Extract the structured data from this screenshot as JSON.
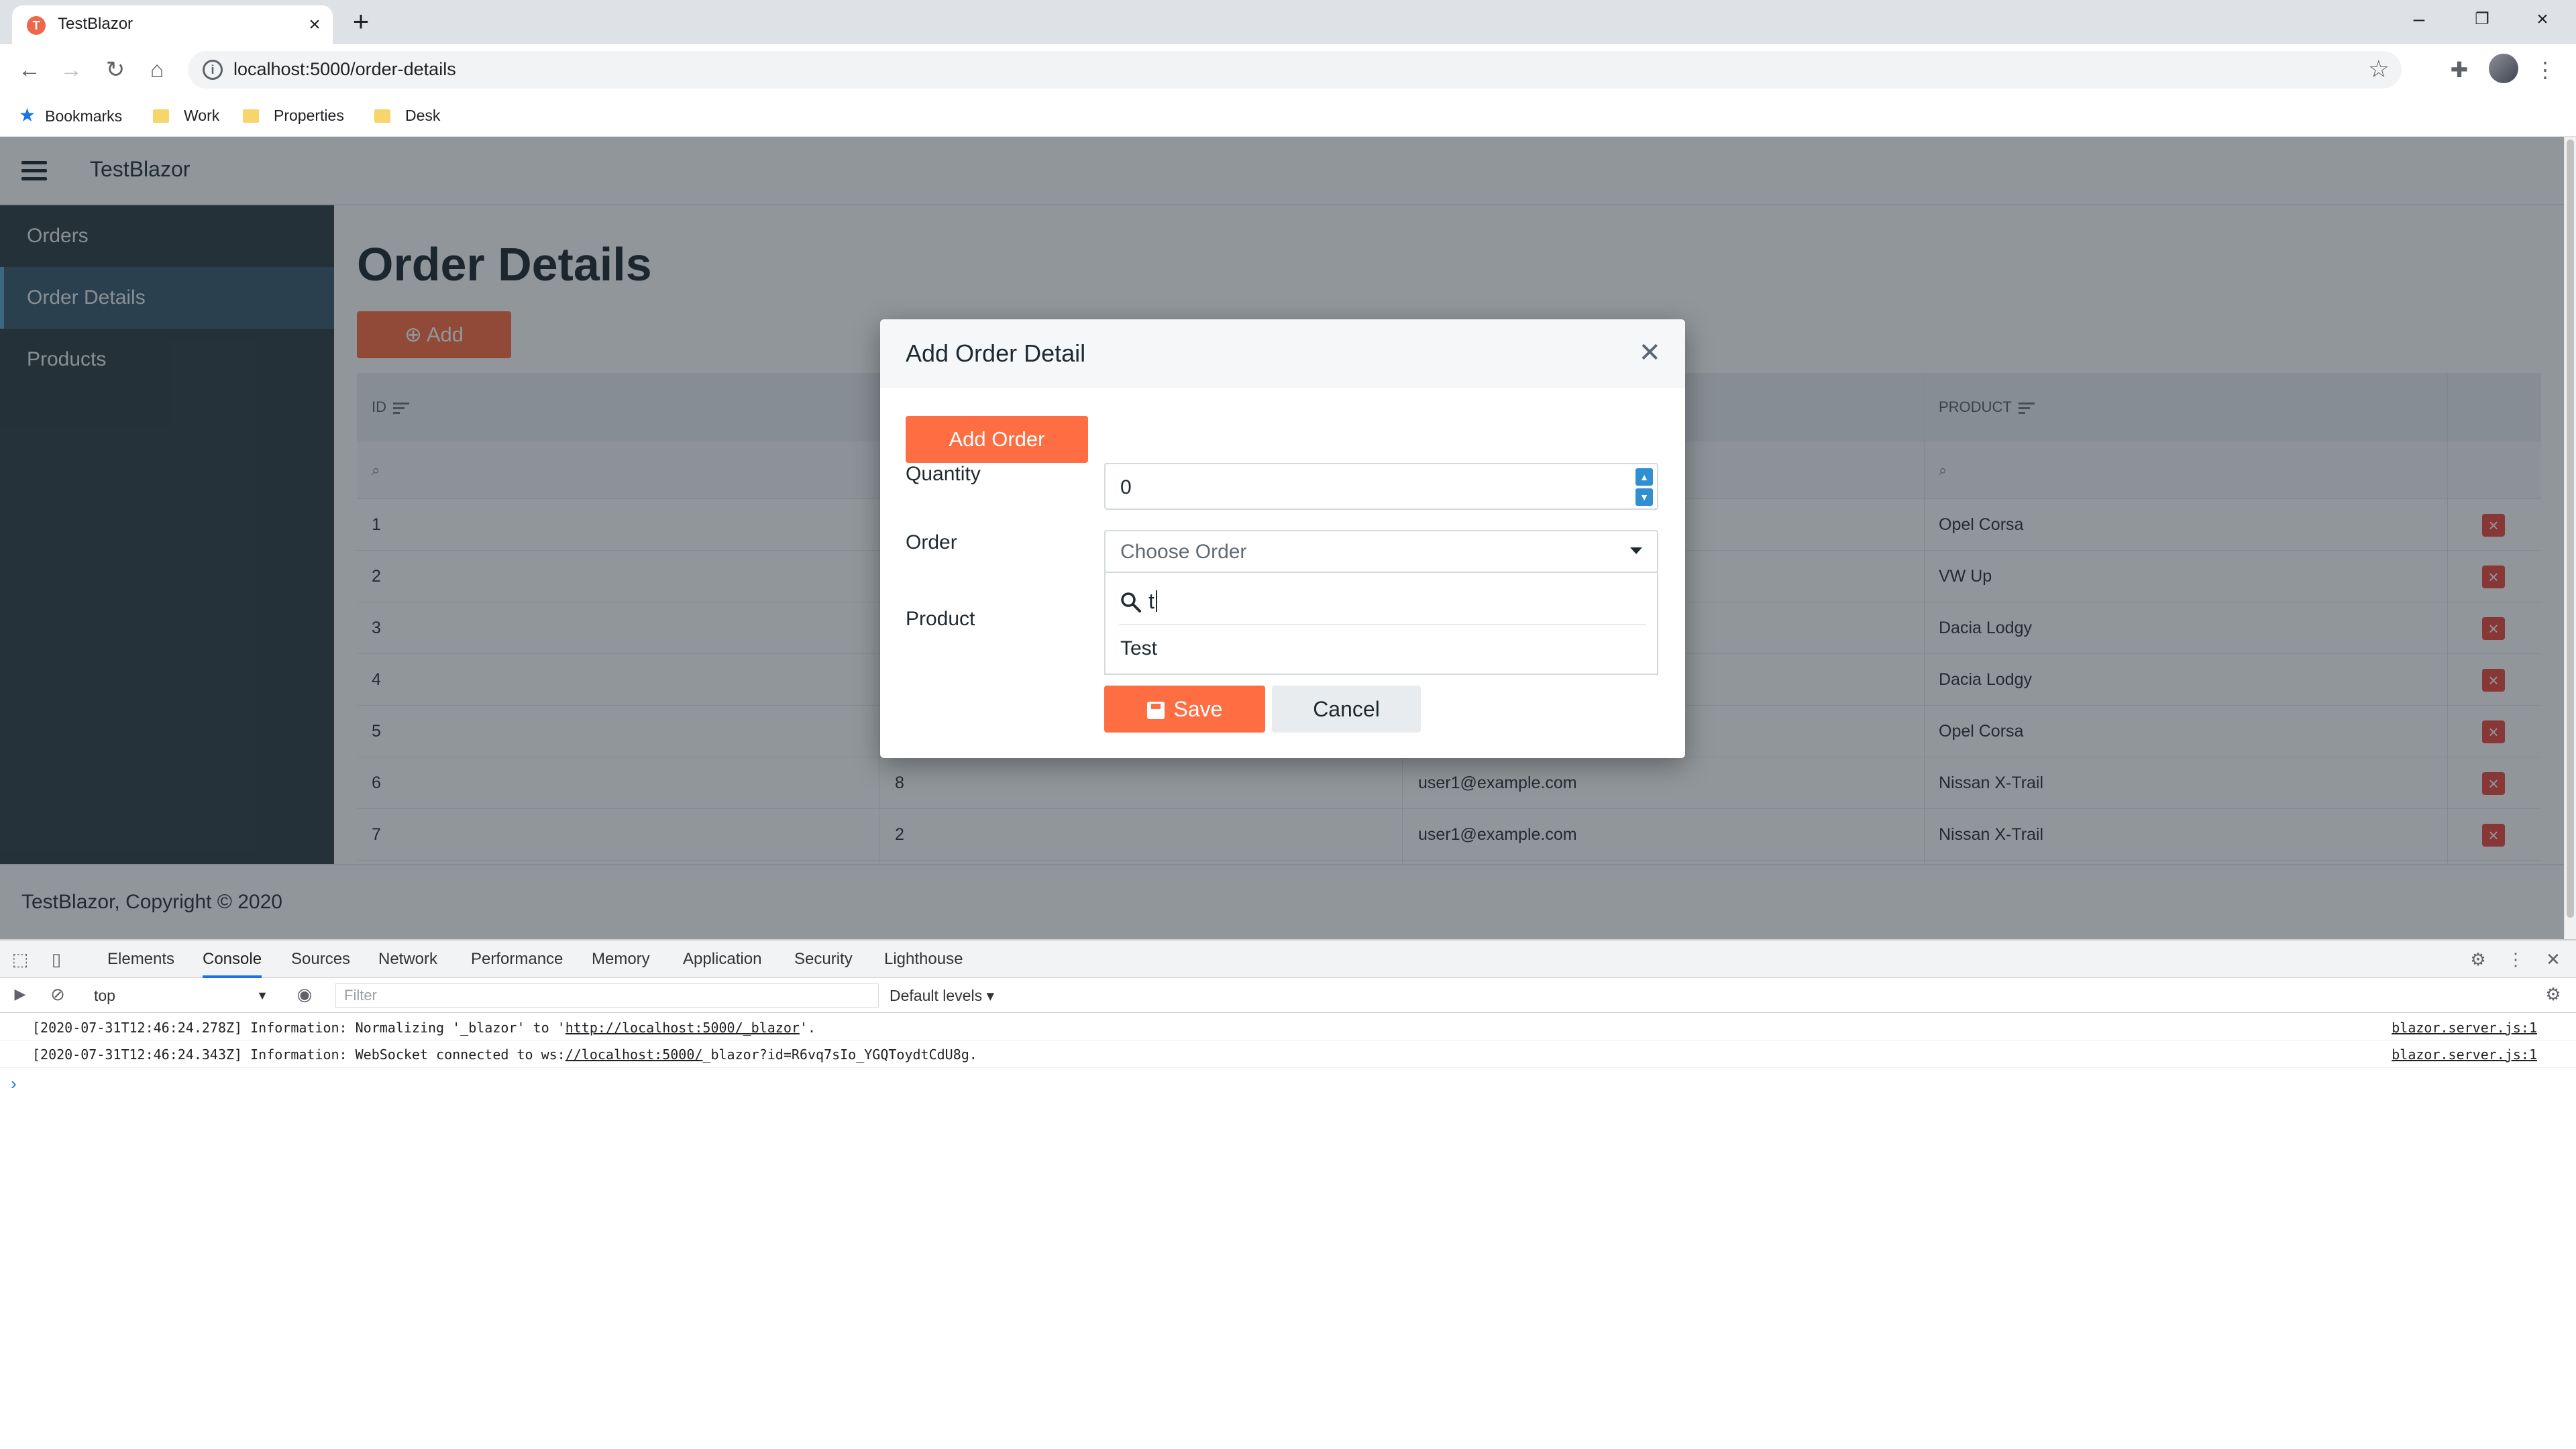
{
  "browser": {
    "tab_title": "TestBlazor",
    "tab_favicon": "T",
    "url": "localhost:5000/order-details",
    "bookmarks": [
      "Bookmarks",
      "Work",
      "Properties",
      "Desk"
    ]
  },
  "app": {
    "brand": "TestBlazor",
    "sidebar": [
      {
        "label": "Orders"
      },
      {
        "label": "Order Details"
      },
      {
        "label": "Products"
      }
    ],
    "page_title": "Order Details",
    "add_label": "Add",
    "grid": {
      "columns": [
        "ID",
        "",
        "",
        "Product"
      ],
      "rows": [
        {
          "id": "1",
          "quantity": "",
          "email": "",
          "product": "Opel Corsa"
        },
        {
          "id": "2",
          "quantity": "",
          "email": "",
          "product": "VW Up"
        },
        {
          "id": "3",
          "quantity": "",
          "email": "",
          "product": "Dacia Lodgy"
        },
        {
          "id": "4",
          "quantity": "",
          "email": "",
          "product": "Dacia Lodgy"
        },
        {
          "id": "5",
          "quantity": "",
          "email": "",
          "product": "Opel Corsa"
        },
        {
          "id": "6",
          "quantity": "8",
          "email": "user1@example.com",
          "product": "Nissan X-Trail"
        },
        {
          "id": "7",
          "quantity": "2",
          "email": "user1@example.com",
          "product": "Nissan X-Trail"
        }
      ]
    },
    "footer": "TestBlazor, Copyright © 2020"
  },
  "dialog": {
    "title": "Add Order Detail",
    "add_order_label": "Add Order",
    "quantity_label": "Quantity",
    "quantity_value": "0",
    "order_label": "Order",
    "order_placeholder": "Choose Order",
    "search_text": "t",
    "option": "Test",
    "product_label": "Product",
    "save_label": "Save",
    "cancel_label": "Cancel"
  },
  "devtools": {
    "tabs": [
      "Elements",
      "Console",
      "Sources",
      "Network",
      "Performance",
      "Memory",
      "Application",
      "Security",
      "Lighthouse"
    ],
    "active_tab": "Console",
    "context": "top",
    "filter_placeholder": "Filter",
    "levels": "Default levels ▾",
    "lines": [
      {
        "pre": "[2020-07-31T12:46:24.278Z] Information: Normalizing '_blazor' to '",
        "link": "http://localhost:5000/_blazor",
        "post": "'.",
        "source": "blazor.server.js:1"
      },
      {
        "pre": "[2020-07-31T12:46:24.343Z] Information: WebSocket connected to ws:",
        "link": "//localhost:5000/",
        "post": "_blazor?id=R6vq7sIo_YGQToydtCdU8g.",
        "source": "blazor.server.js:1"
      }
    ]
  },
  "colors": {
    "accent": "#ff6d42",
    "sidebar": "#2f3e46",
    "delete": "#ee4a42",
    "link_blue": "#1a73e8"
  },
  "icons": [
    "favicon-icon",
    "close-icon",
    "plus-icon",
    "back-icon",
    "forward-icon",
    "reload-icon",
    "home-icon",
    "info-icon",
    "star-icon",
    "extensions-icon",
    "menu-icon",
    "folder-icon",
    "hamburger-icon",
    "sort-icon",
    "search-icon",
    "delete-icon",
    "chevron-down-icon",
    "save-icon",
    "inspect-icon",
    "device-icon",
    "gear-icon",
    "eye-icon",
    "block-icon"
  ]
}
